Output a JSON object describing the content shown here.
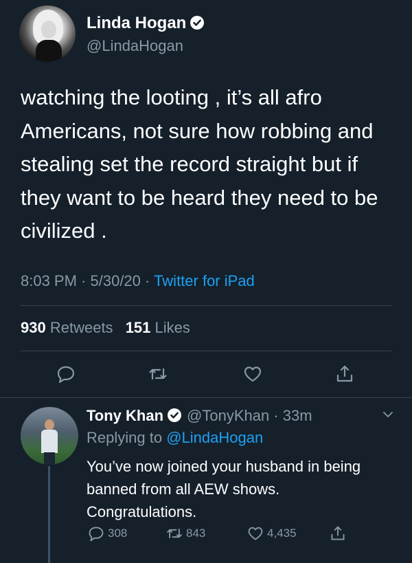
{
  "tweet": {
    "author_name": "Linda Hogan",
    "author_handle": "@LindaHogan",
    "text": "watching the looting , it’s all afro Americans, not sure how robbing and stealing set the record straight but if they want to be heard they need to be civilized .",
    "time": "8:03 PM",
    "date": "5/30/20",
    "source": "Twitter for iPad",
    "retweets_count": "930",
    "retweets_label": "Retweets",
    "likes_count": "151",
    "likes_label": "Likes"
  },
  "reply": {
    "author_name": "Tony Khan",
    "author_handle": "@TonyKhan",
    "age": "33m",
    "replying_to_label": "Replying to",
    "replying_to_handle": "@LindaHogan",
    "text": "You’ve now joined your husband in being banned from all AEW shows. Congratulations.",
    "reply_count": "308",
    "retweet_count": "843",
    "like_count": "4,435"
  },
  "colors": {
    "background": "#15202b",
    "secondary_text": "#8899a6",
    "link": "#1da1f2",
    "divider": "#38444d"
  },
  "icons": [
    "verified-badge-icon",
    "reply-icon",
    "retweet-icon",
    "like-icon",
    "share-icon",
    "chevron-down-icon"
  ]
}
